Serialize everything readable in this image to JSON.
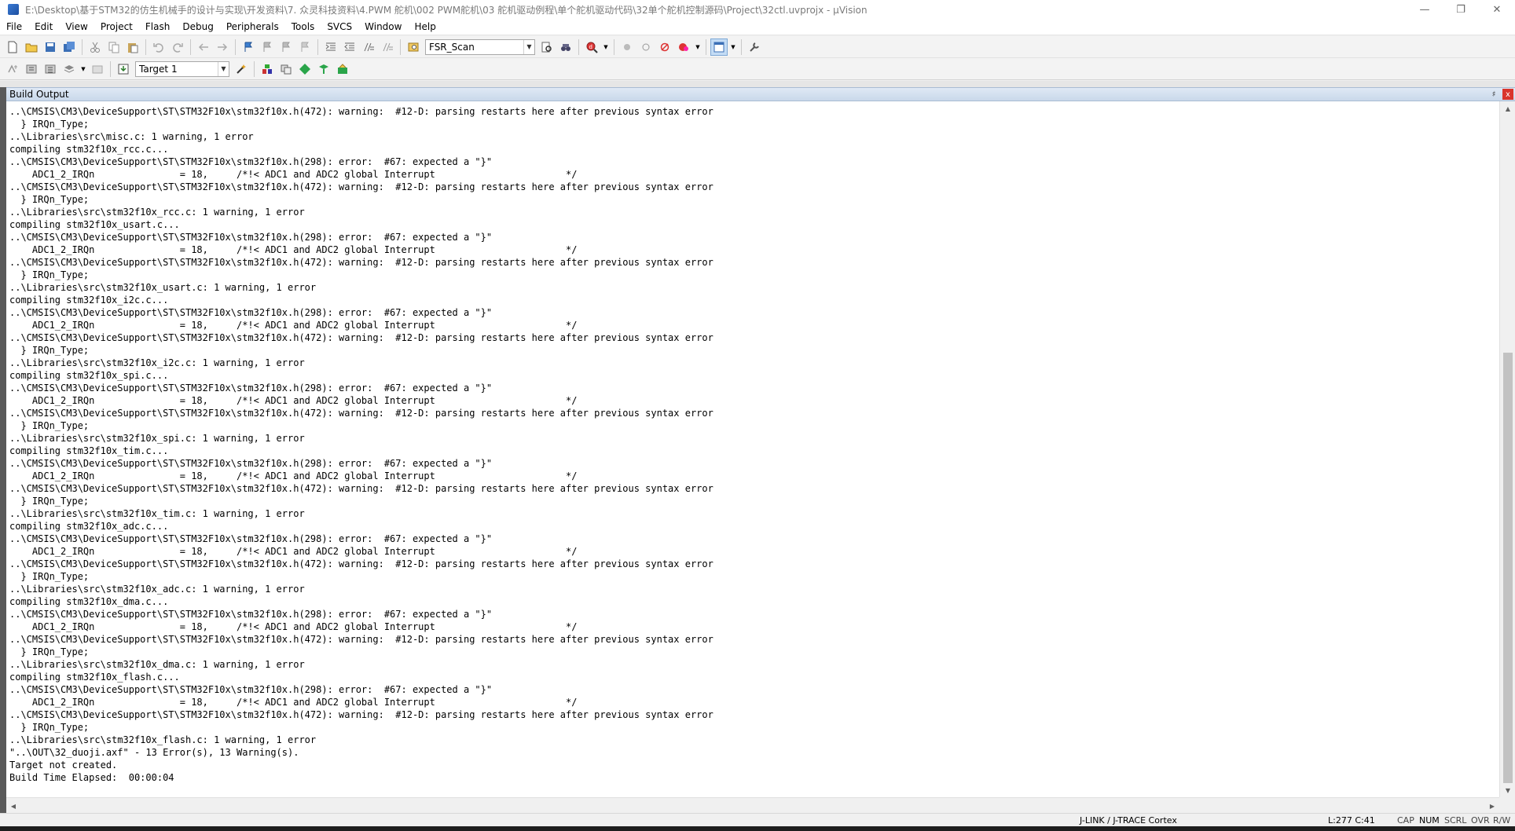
{
  "window": {
    "title": "E:\\Desktop\\基于STM32的仿生机械手的设计与实现\\开发资料\\7. 众灵科技资料\\4.PWM 舵机\\002 PWM舵机\\03 舵机驱动例程\\单个舵机驱动代码\\32单个舵机控制源码\\Project\\32ctl.uvprojx - µVision",
    "minimize_glyph": "—",
    "restore_glyph": "❐",
    "close_glyph": "✕"
  },
  "menu": [
    "File",
    "Edit",
    "View",
    "Project",
    "Flash",
    "Debug",
    "Peripherals",
    "Tools",
    "SVCS",
    "Window",
    "Help"
  ],
  "toolbar": {
    "find_combo": "FSR_Scan",
    "target_combo": "Target 1"
  },
  "panel": {
    "title": "Build Output",
    "pin_glyph": "♯",
    "close_glyph": "x"
  },
  "output_lines": [
    "..\\CMSIS\\CM3\\DeviceSupport\\ST\\STM32F10x\\stm32f10x.h(472): warning:  #12-D: parsing restarts here after previous syntax error",
    "  } IRQn_Type;",
    "..\\Libraries\\src\\misc.c: 1 warning, 1 error",
    "compiling stm32f10x_rcc.c...",
    "..\\CMSIS\\CM3\\DeviceSupport\\ST\\STM32F10x\\stm32f10x.h(298): error:  #67: expected a \"}\"",
    "    ADC1_2_IRQn               = 18,     /*!< ADC1 and ADC2 global Interrupt                       */",
    "..\\CMSIS\\CM3\\DeviceSupport\\ST\\STM32F10x\\stm32f10x.h(472): warning:  #12-D: parsing restarts here after previous syntax error",
    "  } IRQn_Type;",
    "..\\Libraries\\src\\stm32f10x_rcc.c: 1 warning, 1 error",
    "compiling stm32f10x_usart.c...",
    "..\\CMSIS\\CM3\\DeviceSupport\\ST\\STM32F10x\\stm32f10x.h(298): error:  #67: expected a \"}\"",
    "    ADC1_2_IRQn               = 18,     /*!< ADC1 and ADC2 global Interrupt                       */",
    "..\\CMSIS\\CM3\\DeviceSupport\\ST\\STM32F10x\\stm32f10x.h(472): warning:  #12-D: parsing restarts here after previous syntax error",
    "  } IRQn_Type;",
    "..\\Libraries\\src\\stm32f10x_usart.c: 1 warning, 1 error",
    "compiling stm32f10x_i2c.c...",
    "..\\CMSIS\\CM3\\DeviceSupport\\ST\\STM32F10x\\stm32f10x.h(298): error:  #67: expected a \"}\"",
    "    ADC1_2_IRQn               = 18,     /*!< ADC1 and ADC2 global Interrupt                       */",
    "..\\CMSIS\\CM3\\DeviceSupport\\ST\\STM32F10x\\stm32f10x.h(472): warning:  #12-D: parsing restarts here after previous syntax error",
    "  } IRQn_Type;",
    "..\\Libraries\\src\\stm32f10x_i2c.c: 1 warning, 1 error",
    "compiling stm32f10x_spi.c...",
    "..\\CMSIS\\CM3\\DeviceSupport\\ST\\STM32F10x\\stm32f10x.h(298): error:  #67: expected a \"}\"",
    "    ADC1_2_IRQn               = 18,     /*!< ADC1 and ADC2 global Interrupt                       */",
    "..\\CMSIS\\CM3\\DeviceSupport\\ST\\STM32F10x\\stm32f10x.h(472): warning:  #12-D: parsing restarts here after previous syntax error",
    "  } IRQn_Type;",
    "..\\Libraries\\src\\stm32f10x_spi.c: 1 warning, 1 error",
    "compiling stm32f10x_tim.c...",
    "..\\CMSIS\\CM3\\DeviceSupport\\ST\\STM32F10x\\stm32f10x.h(298): error:  #67: expected a \"}\"",
    "    ADC1_2_IRQn               = 18,     /*!< ADC1 and ADC2 global Interrupt                       */",
    "..\\CMSIS\\CM3\\DeviceSupport\\ST\\STM32F10x\\stm32f10x.h(472): warning:  #12-D: parsing restarts here after previous syntax error",
    "  } IRQn_Type;",
    "..\\Libraries\\src\\stm32f10x_tim.c: 1 warning, 1 error",
    "compiling stm32f10x_adc.c...",
    "..\\CMSIS\\CM3\\DeviceSupport\\ST\\STM32F10x\\stm32f10x.h(298): error:  #67: expected a \"}\"",
    "    ADC1_2_IRQn               = 18,     /*!< ADC1 and ADC2 global Interrupt                       */",
    "..\\CMSIS\\CM3\\DeviceSupport\\ST\\STM32F10x\\stm32f10x.h(472): warning:  #12-D: parsing restarts here after previous syntax error",
    "  } IRQn_Type;",
    "..\\Libraries\\src\\stm32f10x_adc.c: 1 warning, 1 error",
    "compiling stm32f10x_dma.c...",
    "..\\CMSIS\\CM3\\DeviceSupport\\ST\\STM32F10x\\stm32f10x.h(298): error:  #67: expected a \"}\"",
    "    ADC1_2_IRQn               = 18,     /*!< ADC1 and ADC2 global Interrupt                       */",
    "..\\CMSIS\\CM3\\DeviceSupport\\ST\\STM32F10x\\stm32f10x.h(472): warning:  #12-D: parsing restarts here after previous syntax error",
    "  } IRQn_Type;",
    "..\\Libraries\\src\\stm32f10x_dma.c: 1 warning, 1 error",
    "compiling stm32f10x_flash.c...",
    "..\\CMSIS\\CM3\\DeviceSupport\\ST\\STM32F10x\\stm32f10x.h(298): error:  #67: expected a \"}\"",
    "    ADC1_2_IRQn               = 18,     /*!< ADC1 and ADC2 global Interrupt                       */",
    "..\\CMSIS\\CM3\\DeviceSupport\\ST\\STM32F10x\\stm32f10x.h(472): warning:  #12-D: parsing restarts here after previous syntax error",
    "  } IRQn_Type;",
    "..\\Libraries\\src\\stm32f10x_flash.c: 1 warning, 1 error",
    "\"..\\OUT\\32_duoji.axf\" - 13 Error(s), 13 Warning(s).",
    "Target not created.",
    "Build Time Elapsed:  00:00:04"
  ],
  "statusbar": {
    "debugger": "J-LINK / J-TRACE Cortex",
    "position": "L:277 C:41",
    "cap": "CAP",
    "num": "NUM",
    "scrl": "SCRL",
    "ovr": "OVR",
    "rw": "R/W"
  },
  "colors": {
    "close_button": "#d9342b",
    "panel_header": "#c9d8ea",
    "output_bg": "#ffffff"
  }
}
